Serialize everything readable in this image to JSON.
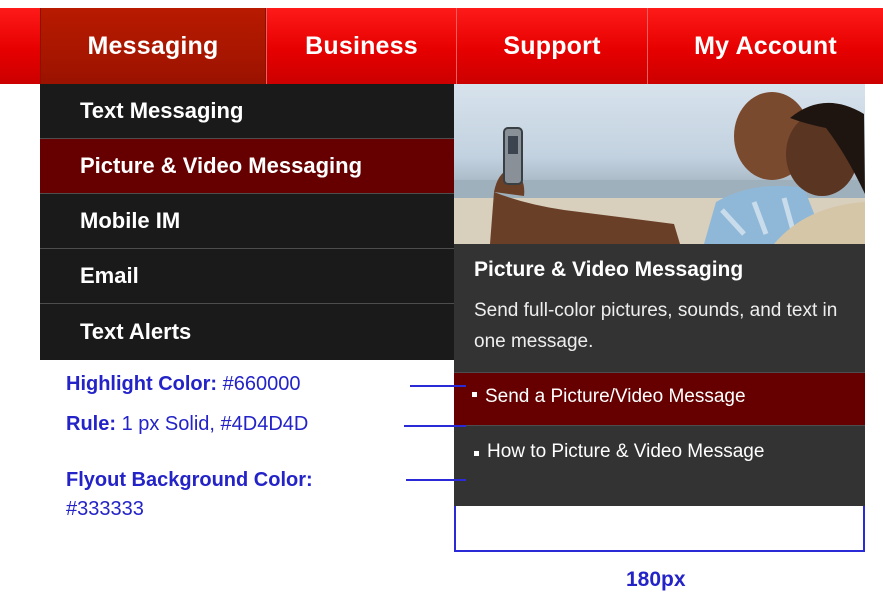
{
  "nav": {
    "tabs": [
      {
        "label": "Messaging",
        "active": true
      },
      {
        "label": "Business",
        "active": false
      },
      {
        "label": "Support",
        "active": false
      },
      {
        "label": "My Account",
        "active": false
      }
    ]
  },
  "submenu": {
    "items": [
      {
        "label": "Text Messaging"
      },
      {
        "label": "Picture & Video Messaging",
        "highlighted": true
      },
      {
        "label": "Mobile IM"
      },
      {
        "label": "Email"
      },
      {
        "label": "Text Alerts"
      }
    ]
  },
  "flyout": {
    "title": "Picture & Video Messaging",
    "description": "Send full-color pictures, sounds, and text in one message.",
    "links": [
      {
        "label": "Send a Picture/Video Message",
        "highlighted": true
      },
      {
        "label": "How to Picture & Video Message"
      }
    ]
  },
  "annotations": {
    "highlight_label": "Highlight Color:",
    "highlight_value": "#660000",
    "rule_label": "Rule:",
    "rule_value": "1 px Solid, #4D4D4D",
    "flyout_label": "Flyout Background Color:",
    "flyout_value": "#333333",
    "width_label": "180px"
  },
  "colors": {
    "nav_red": "#e60000",
    "highlight": "#660000",
    "rule": "#4d4d4d",
    "flyout_bg": "#333333",
    "menu_bg": "#1a1a1a",
    "annotation_blue": "#2323c8"
  },
  "icons": {
    "bullet": "square-bullet-icon"
  }
}
